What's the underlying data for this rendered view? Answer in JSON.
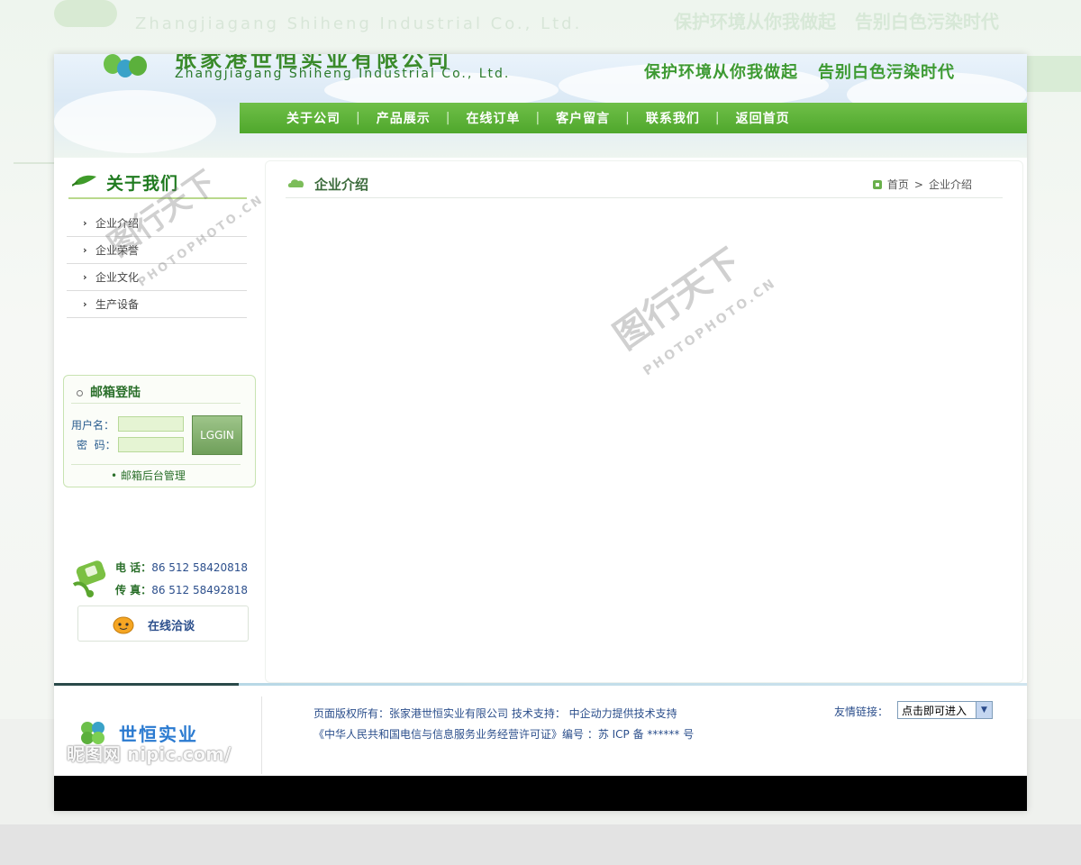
{
  "header": {
    "company_cn": "张家港世恒实业有限公司",
    "company_en": "Zhangjiagang Shiheng Industrial Co., Ltd.",
    "slogan_1": "保护环境从你我做起",
    "slogan_2": "告别白色污染时代"
  },
  "nav": {
    "items": [
      "关于公司",
      "产品展示",
      "在线订单",
      "客户留言",
      "联系我们",
      "返回首页"
    ],
    "separator": "|"
  },
  "sidebar": {
    "title": "关于我们",
    "items": [
      "企业介绍",
      "企业荣誉",
      "企业文化",
      "生产设备"
    ],
    "arrow": "›"
  },
  "mail_login": {
    "title": "邮箱登陆",
    "username_label": "用户名：",
    "password_label": "密  码：",
    "login_button": "LGGIN",
    "admin_link": "• 邮箱后台管理"
  },
  "contact": {
    "phone_label": "电 话：",
    "phone": "86 512 58420818",
    "fax_label": "传 真：",
    "fax": "86 512 58492818",
    "chat": "在线洽谈"
  },
  "content": {
    "title": "企业介绍",
    "breadcrumb_home": "首页",
    "breadcrumb_sep": ">",
    "breadcrumb_current": "企业介绍"
  },
  "watermark": {
    "cn": "图行天下",
    "en": "PHOTOPHOTO.CN",
    "footer": "昵图网 nipic.com/"
  },
  "footer": {
    "brand": "世恒实业",
    "line1": "页面版权所有：张家港世恒实业有限公司  技术支持：  中企动力提供技术支持",
    "line2": "《中华人民共和国电信与信息服务业务经营许可证》编号 ：苏 ICP 备 ****** 号",
    "friend_links_label": "友情链接：",
    "friend_links_value": "点击即可进入"
  },
  "colors": {
    "nav_green": "#4fa72c",
    "title_green": "#1f7a1f",
    "link_blue": "#2c4f8c"
  }
}
